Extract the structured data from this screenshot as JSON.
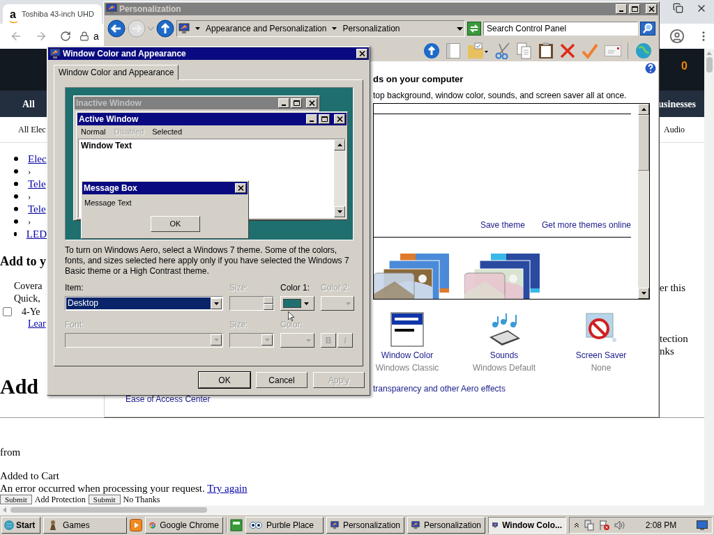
{
  "browser": {
    "tab_title": "Toshiba 43-inch UHD",
    "logo": "a",
    "address": "a",
    "cart_count": "0",
    "nav_all": "All",
    "nav_right": "usinesses",
    "subnav_left": "All Elec",
    "subnav_right": "Audio"
  },
  "page": {
    "breadcrumbs": [
      {
        "kind": "link",
        "text": "Elec"
      },
      {
        "kind": "separator",
        "text": "›"
      },
      {
        "kind": "link",
        "text": "Tele"
      },
      {
        "kind": "separator",
        "text": "›"
      },
      {
        "kind": "link",
        "text": "Tele"
      },
      {
        "kind": "separator",
        "text": "›"
      },
      {
        "kind": "link",
        "text": "LED"
      }
    ],
    "heading": "Add to y",
    "coverage_lines": [
      "Covera",
      "Quick,"
    ],
    "option": {
      "checked": false,
      "text": "4-Ye",
      "link": "Lear"
    },
    "right_fragments": [
      "er this",
      "tection",
      "nks"
    ],
    "big_heading": "Add",
    "from": "from",
    "added": "Added to Cart",
    "error": {
      "text": "An error occurred when processing your request.",
      "link": "Try again"
    },
    "actions": [
      {
        "kind": "button",
        "text": "Submit"
      },
      {
        "kind": "text",
        "text": "Add Protection"
      },
      {
        "kind": "button",
        "text": "Submit"
      },
      {
        "kind": "text",
        "text": "No Thanks"
      }
    ]
  },
  "personalization": {
    "title": "Personalization",
    "active": false,
    "breadcrumb": [
      "Appearance and Personalization",
      "Personalization"
    ],
    "search": {
      "placeholder": "Search Control Panel"
    },
    "heading": "ds on your computer",
    "description": "top background, window color, sounds, and screen saver all at once.",
    "theme_links": [
      "Save theme",
      "Get more themes online"
    ],
    "settings": [
      {
        "kind": "window_color",
        "label": "Window Color",
        "value": "Windows Classic"
      },
      {
        "kind": "sounds",
        "label": "Sounds",
        "value": "Windows Default"
      },
      {
        "kind": "screen_saver",
        "label": "Screen Saver",
        "value": "None"
      }
    ],
    "aero_link": "transparency and other Aero effects",
    "see_also": "Ease of Access Center"
  },
  "dialog": {
    "title": "Window Color and Appearance",
    "active": true,
    "tabs": [
      {
        "label": "Window Color and Appearance",
        "selected": true
      }
    ],
    "preview": {
      "inactive_title": "Inactive Window",
      "active_title": "Active Window",
      "menu": [
        {
          "label": "Normal",
          "disabled": false
        },
        {
          "label": "Disabled",
          "disabled": true
        },
        {
          "label": "Selected",
          "disabled": false
        }
      ],
      "window_text": "Window Text",
      "message_title": "Message Box",
      "message_text": "Message Text",
      "message_button": "OK"
    },
    "note": "To turn on Windows Aero, select a Windows 7 theme. Some of the colors, fonts, and sizes selected here apply only if you have selected the Windows 7 Basic theme or a High Contrast theme.",
    "item": {
      "label": "Item:",
      "value": "Desktop",
      "disabled": false
    },
    "item_size": {
      "label": "Size:",
      "disabled": true
    },
    "color1": {
      "label": "Color 1:",
      "disabled": false
    },
    "color2": {
      "label": "Color 2:",
      "disabled": true
    },
    "font": {
      "label": "Font:",
      "disabled": true
    },
    "font_size": {
      "label": "Size:",
      "disabled": true
    },
    "font_color": {
      "label": "Color:",
      "disabled": true
    },
    "bold": {
      "label": "B",
      "disabled": true
    },
    "italic": {
      "label": "I",
      "disabled": true
    },
    "buttons": [
      {
        "label": "OK",
        "default": true,
        "disabled": false
      },
      {
        "label": "Cancel",
        "default": false,
        "disabled": false
      },
      {
        "label": "Apply",
        "default": false,
        "disabled": true
      }
    ]
  },
  "taskbar": {
    "start": "Start",
    "tasks": [
      {
        "label": "Games",
        "selected": false
      },
      {
        "label": "Google Chrome",
        "selected": false
      },
      {
        "label": "Purble Place",
        "selected": false
      },
      {
        "label": "Personalization",
        "selected": false
      },
      {
        "label": "Personalization",
        "selected": false
      },
      {
        "label": "Window Colo...",
        "selected": true
      }
    ],
    "clock": "2:08 PM"
  }
}
